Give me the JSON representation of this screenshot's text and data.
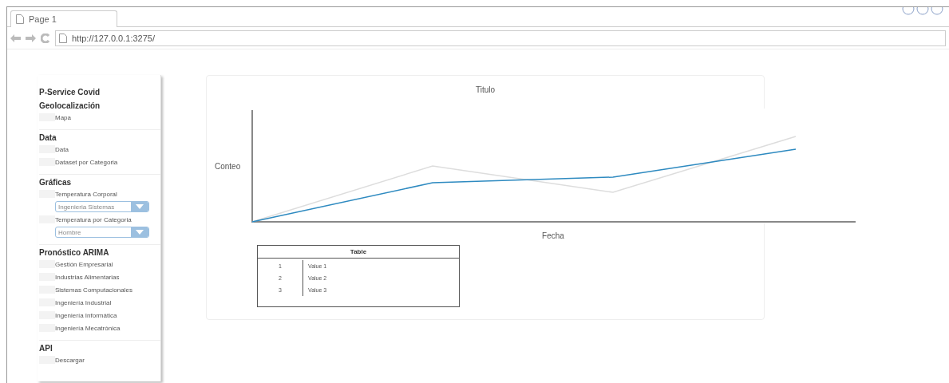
{
  "browser": {
    "tab": {
      "label": "Page 1",
      "selected": true
    },
    "url": "http://127.0.0.1:3275/"
  },
  "sidebar": {
    "title": "P-Service Covid",
    "sections": [
      {
        "title": "Geolocalización",
        "items": [
          {
            "kind": "link",
            "label": "Mapa"
          }
        ]
      },
      {
        "title": "Data",
        "items": [
          {
            "kind": "link",
            "label": "Data"
          },
          {
            "kind": "link",
            "label": "Dataset por Categoria"
          }
        ]
      },
      {
        "title": "Gráficas",
        "items": [
          {
            "kind": "link",
            "label": "Temperatura Corporal"
          },
          {
            "kind": "select",
            "value": "Ingenieria Sistemas"
          },
          {
            "kind": "link",
            "label": "Temperatura por Categoria"
          },
          {
            "kind": "select",
            "value": "Hombre"
          }
        ]
      },
      {
        "title": "Pronóstico ARIMA",
        "items": [
          {
            "kind": "link",
            "label": "Gestión Empresarial"
          },
          {
            "kind": "link",
            "label": "Industrias Alimentarias"
          },
          {
            "kind": "link",
            "label": "Sistemas Computacionales"
          },
          {
            "kind": "link",
            "label": "Ingeniería Industrial"
          },
          {
            "kind": "link",
            "label": "Ingeniería Informática"
          },
          {
            "kind": "link",
            "label": "Ingeniería Mecatrónica"
          }
        ]
      },
      {
        "title": "API",
        "items": [
          {
            "kind": "link",
            "label": "Descargar"
          }
        ]
      }
    ]
  },
  "chart": {
    "title": "Titulo",
    "ylabel": "Conteo",
    "xlabel": "Fecha"
  },
  "table": {
    "title": "Table",
    "rows": [
      {
        "index": "1",
        "value": "Value 1"
      },
      {
        "index": "2",
        "value": "Value 2"
      },
      {
        "index": "3",
        "value": "Value 3"
      }
    ]
  }
}
